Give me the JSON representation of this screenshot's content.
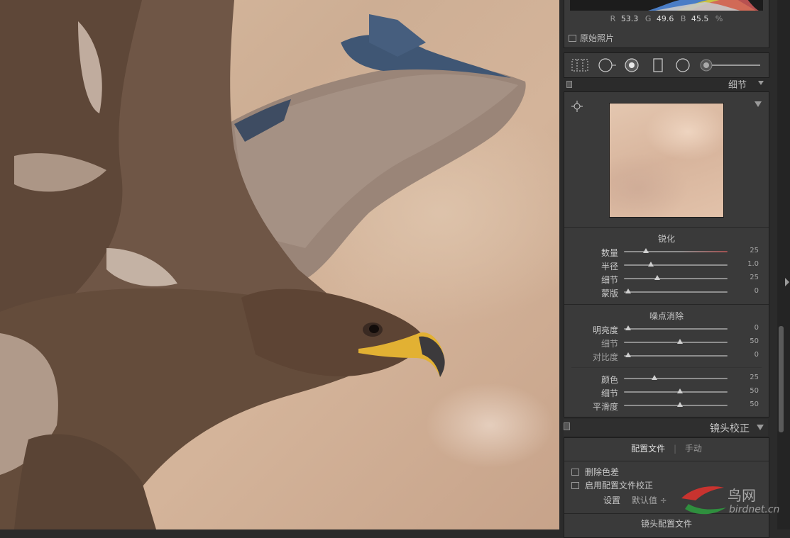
{
  "histogram": {
    "r_label": "R",
    "r_value": "53.3",
    "g_label": "G",
    "g_value": "49.6",
    "b_label": "B",
    "b_value": "45.5",
    "unit": "%",
    "original_photo_label": "原始照片"
  },
  "detail_panel": {
    "title": "细节",
    "sharpening": {
      "title": "锐化",
      "sliders": [
        {
          "label": "数量",
          "value": "25",
          "level": 0.17
        },
        {
          "label": "半径",
          "value": "1.0",
          "level": 0.22
        },
        {
          "label": "细节",
          "value": "25",
          "level": 0.28
        },
        {
          "label": "蒙版",
          "value": "0",
          "level": 0.0
        }
      ]
    },
    "noise_reduction": {
      "title": "噪点消除",
      "sliders": [
        {
          "label": "明亮度",
          "value": "0",
          "level": 0.0
        },
        {
          "label": "细节",
          "value": "50",
          "level": 0.5,
          "dim": true
        },
        {
          "label": "对比度",
          "value": "0",
          "level": 0.0,
          "dim": true
        },
        {
          "label": "颜色",
          "value": "25",
          "level": 0.25
        },
        {
          "label": "细节",
          "value": "50",
          "level": 0.5
        },
        {
          "label": "平滑度",
          "value": "50",
          "level": 0.5
        }
      ]
    }
  },
  "lens_panel": {
    "title": "镜头校正",
    "tabs": {
      "profile": "配置文件",
      "manual": "手动"
    },
    "remove_ca": "删除色差",
    "enable_profile": "启用配置文件校正",
    "setup_label": "设置",
    "setup_value": "默认值 ÷",
    "lens_profile_title": "镜头配置文件"
  },
  "watermark": {
    "text_cn": "鸟网",
    "text_en": "birdnet.cn"
  }
}
